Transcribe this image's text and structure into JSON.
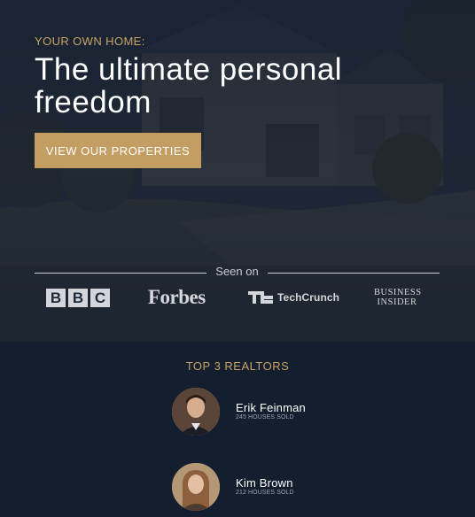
{
  "hero": {
    "eyebrow": "YOUR OWN HOME:",
    "headline": "The ultimate personal freedom",
    "cta_label": "VIEW OUR PROPERTIES"
  },
  "seen_on": {
    "label": "Seen on",
    "logos": [
      {
        "name": "BBC",
        "letters": [
          "B",
          "B",
          "C"
        ]
      },
      {
        "name": "Forbes"
      },
      {
        "name": "TechCrunch"
      },
      {
        "name": "Business Insider",
        "line1": "BUSINESS",
        "line2": "INSIDER"
      }
    ]
  },
  "realtors": {
    "title": "TOP 3 REALTORS",
    "items": [
      {
        "name": "Erik Feinman",
        "meta": "245 HOUSES SOLD"
      },
      {
        "name": "Kim Brown",
        "meta": "212 HOUSES SOLD"
      }
    ]
  },
  "colors": {
    "accent": "#c49d63",
    "background": "#131e2e"
  }
}
